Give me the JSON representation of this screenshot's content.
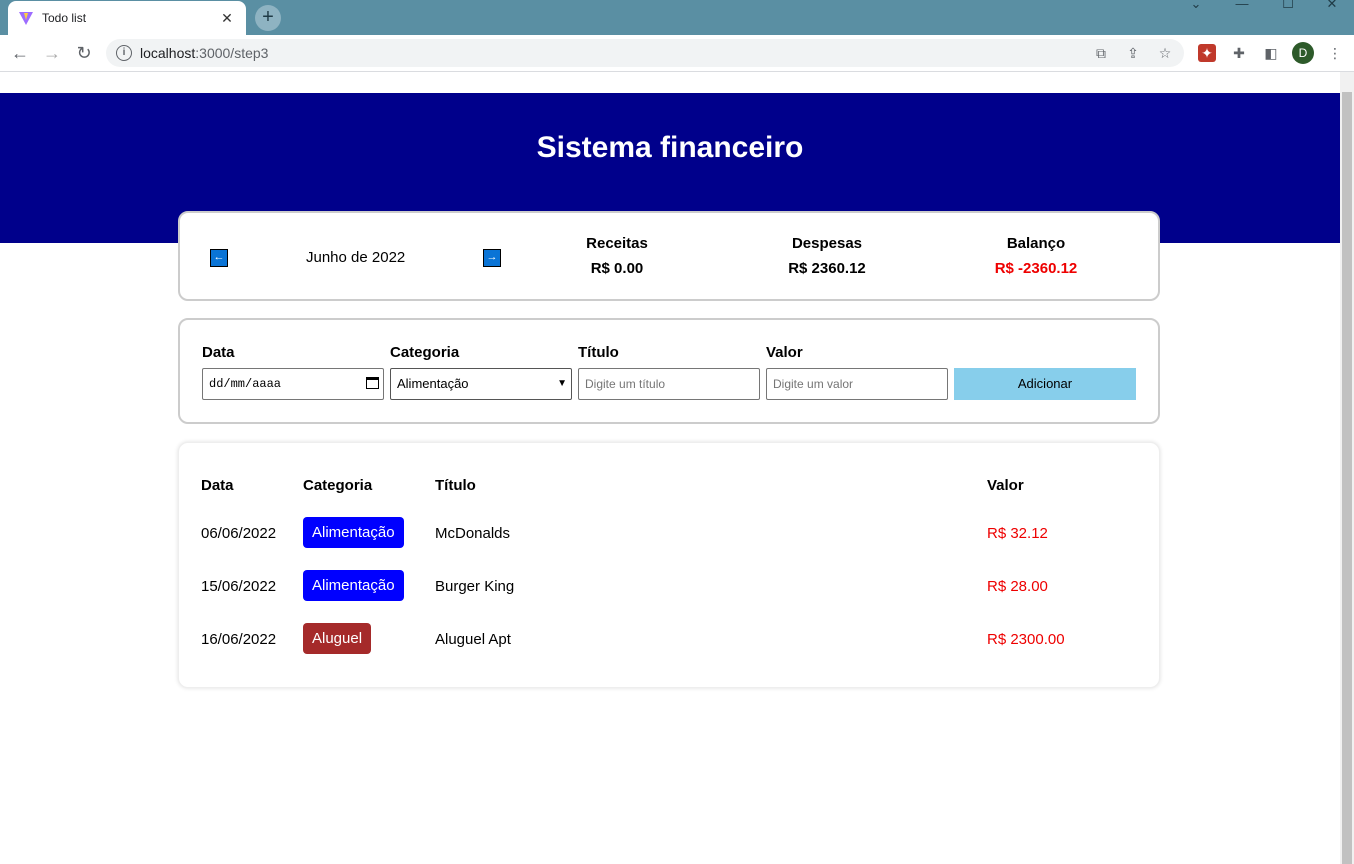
{
  "browser": {
    "tab_title": "Todo list",
    "url_host": "localhost",
    "url_path": ":3000/step3",
    "avatar_letter": "D",
    "colors": {
      "tabbar": "#5a8fa3"
    }
  },
  "header": {
    "title": "Sistema financeiro",
    "color": "#00008b"
  },
  "info": {
    "month": "Junho de 2022",
    "prev_icon": "←",
    "next_icon": "→",
    "receitas_label": "Receitas",
    "receitas_value": "R$ 0.00",
    "despesas_label": "Despesas",
    "despesas_value": "R$ 2360.12",
    "balanco_label": "Balanço",
    "balanco_value": "R$ -2360.12"
  },
  "form": {
    "date_label": "Data",
    "date_placeholder": "dd/mm/aaaa",
    "category_label": "Categoria",
    "category_selected": "Alimentação",
    "title_label": "Título",
    "title_placeholder": "Digite um título",
    "value_label": "Valor",
    "value_placeholder": "Digite um valor",
    "add_button": "Adicionar"
  },
  "table": {
    "headers": [
      "Data",
      "Categoria",
      "Título",
      "Valor"
    ],
    "rows": [
      {
        "date": "06/06/2022",
        "category": "Alimentação",
        "category_color": "#0000ff",
        "title": "McDonalds",
        "value": "R$ 32.12"
      },
      {
        "date": "15/06/2022",
        "category": "Alimentação",
        "category_color": "#0000ff",
        "title": "Burger King",
        "value": "R$ 28.00"
      },
      {
        "date": "16/06/2022",
        "category": "Aluguel",
        "category_color": "#a52a2a",
        "title": "Aluguel Apt",
        "value": "R$ 2300.00"
      }
    ]
  }
}
